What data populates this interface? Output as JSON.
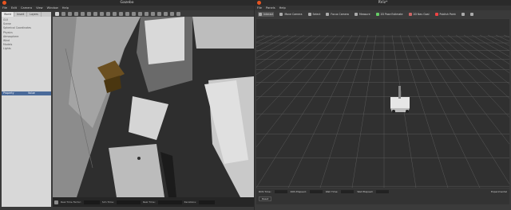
{
  "gazebo": {
    "title": "Gazebo",
    "menu": [
      "File",
      "Edit",
      "Camera",
      "View",
      "Window",
      "Help"
    ],
    "tabs": [
      "World",
      "Insert",
      "Layers"
    ],
    "tree": [
      "GUI",
      "Scene",
      "Spherical Coordinates",
      "Physics",
      "Atmosphere",
      "Wind",
      "Models",
      "Lights"
    ],
    "props": {
      "property": "Property",
      "value": "Value"
    },
    "status": [
      "Real Time Factor:",
      "Sim Time:",
      "Real Time:",
      "Iterations:"
    ]
  },
  "rviz": {
    "title": "RViz*",
    "menu": [
      "File",
      "Panels",
      "Help"
    ],
    "tools": [
      "Interact",
      "Move Camera",
      "Select",
      "Focus Camera",
      "Measure",
      "2D Pose Estimate",
      "2D Nav Goal",
      "Publish Point"
    ],
    "time": {
      "ros_time": "ROS Time:",
      "ros_elapsed": "ROS Elapsed:",
      "wall_time": "Wall Time:",
      "wall_elapsed": "Wall Elapsed:",
      "experimental": "Experimental",
      "reset": "Reset"
    }
  }
}
